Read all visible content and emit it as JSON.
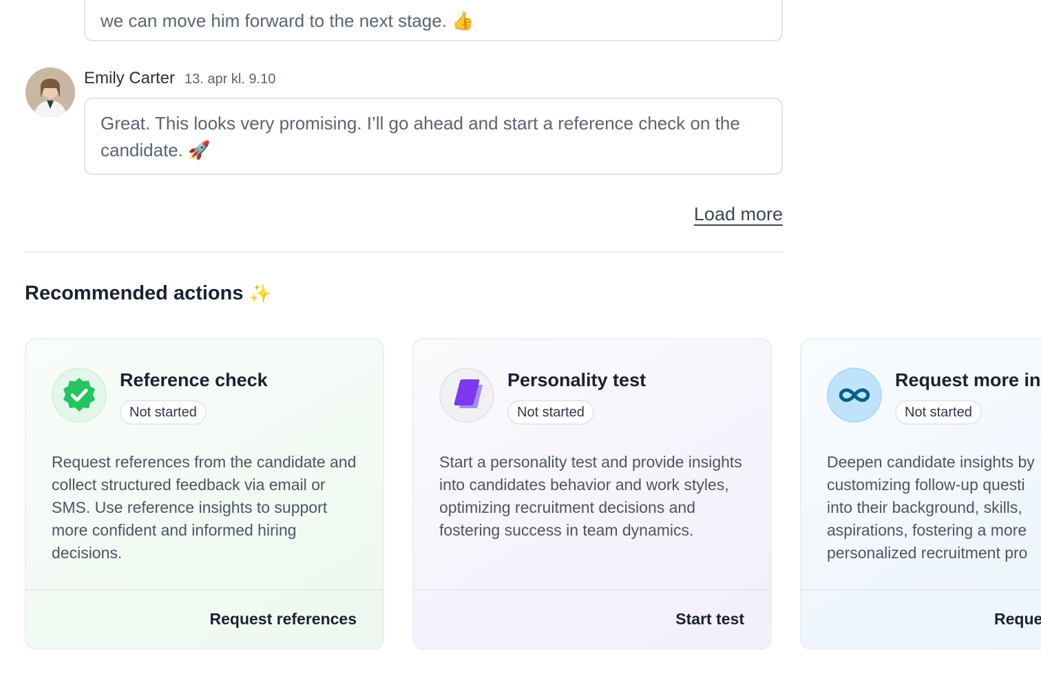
{
  "comments": [
    {
      "text": "we can move him forward to the next stage. 👍"
    },
    {
      "author": "Emily Carter",
      "time": "13. apr kl. 9.10",
      "text": "Great. This looks very promising. I’ll go ahead and start a reference check on the candidate. 🚀"
    }
  ],
  "load_more_label": "Load more",
  "recommended": {
    "title": "Recommended actions",
    "title_emoji": "✨",
    "cards": [
      {
        "title": "Reference check",
        "status": "Not started",
        "description": "Request references from the candidate and collect structured feedback via email or SMS. Use reference insights to support more confident and informed hiring decisions.",
        "action": "Request references",
        "icon": "verified-badge-icon",
        "accent": "#22c55e"
      },
      {
        "title": "Personality test",
        "status": "Not started",
        "description": "Start a personality test and provide insights into candidates behavior and work styles, optimizing recruitment decisions and fostering success in team dynamics.",
        "action": "Start test",
        "icon": "layers-icon",
        "accent": "#7c3aed"
      },
      {
        "title": "Request more inf",
        "status": "Not started",
        "desc_lines": [
          "Deepen candidate insights by",
          "customizing follow-up questi",
          "into their background, skills,",
          "aspirations, fostering a more",
          "personalized recruitment pro"
        ],
        "action": "Reque",
        "icon": "infinity-icon",
        "accent": "#0b5d8f"
      }
    ]
  }
}
